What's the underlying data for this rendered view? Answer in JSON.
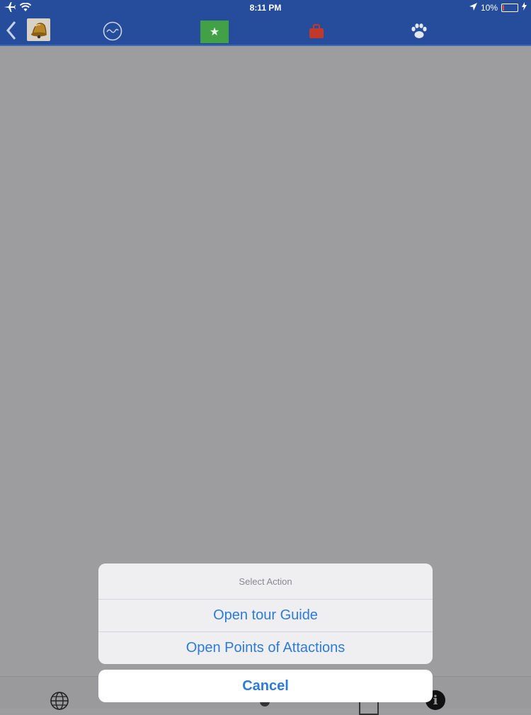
{
  "status_bar": {
    "time": "8:11 PM",
    "battery_text": "10%",
    "battery_level": 0.1
  },
  "nav": {
    "back_icon": "chevron-left-icon",
    "icons": [
      "bell-icon",
      "wave-icon",
      "star-icon",
      "bag-icon",
      "paw-icon"
    ],
    "active_color": "#42a047",
    "bar_color": "#254d9c"
  },
  "action_sheet": {
    "title": "Select Action",
    "items": [
      {
        "label": "Open tour Guide"
      },
      {
        "label": "Open Points of Attactions"
      }
    ],
    "cancel_label": "Cancel",
    "accent_color": "#2c7bd9"
  },
  "bottom_toolbar": {
    "icons": [
      "globe-icon",
      "pin-icon",
      "square-icon",
      "info-icon"
    ]
  }
}
